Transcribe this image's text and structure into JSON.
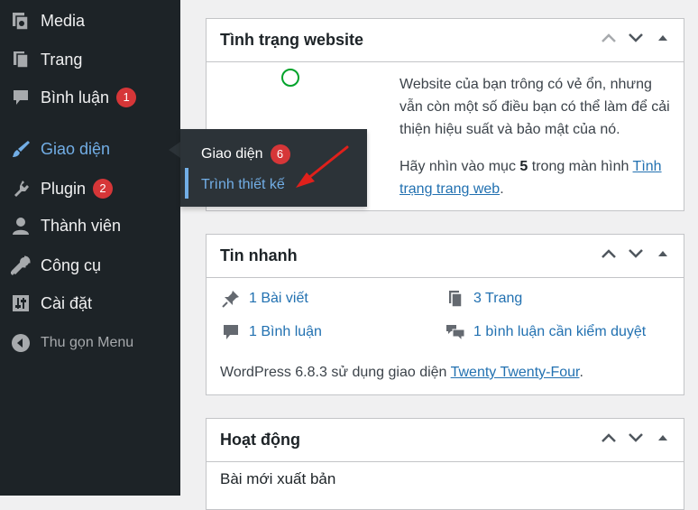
{
  "sidebar": {
    "items": [
      {
        "label": "Media",
        "icon": "media-icon"
      },
      {
        "label": "Trang",
        "icon": "pages-icon"
      },
      {
        "label": "Bình luận",
        "icon": "comments-icon",
        "badge": "1"
      },
      {
        "label": "Giao diện",
        "icon": "appearance-icon",
        "active": true
      },
      {
        "label": "Plugin",
        "icon": "plugins-icon",
        "badge": "2"
      },
      {
        "label": "Thành viên",
        "icon": "users-icon"
      },
      {
        "label": "Công cụ",
        "icon": "tools-icon"
      },
      {
        "label": "Cài đặt",
        "icon": "settings-icon"
      }
    ],
    "collapse_label": "Thu gọn Menu"
  },
  "flyout": {
    "title": "Giao diện",
    "badge": "6",
    "sub_item": "Trình thiết kế"
  },
  "site_health": {
    "title": "Tình trạng website",
    "message": "Website của bạn trông có vẻ ổn, nhưng vẫn còn một số điều bạn có thể làm để cải thiện hiệu suất và bảo mật của nó.",
    "hint_prefix": "Hãy nhìn vào mục",
    "hint_count": "5",
    "hint_middle": "trong màn hình",
    "hint_link": "Tình trạng trang web",
    "hint_suffix": "."
  },
  "at_a_glance": {
    "title": "Tin nhanh",
    "posts": "1 Bài viết",
    "pages": "3 Trang",
    "comments": "1 Bình luận",
    "moderation": "1 bình luận cần kiểm duyệt",
    "wp_prefix": "WordPress 6.8.3 sử dụng giao diện",
    "theme_link": "Twenty Twenty-Four",
    "wp_suffix": "."
  },
  "activity": {
    "title": "Hoạt động",
    "recent_label": "Bài mới xuất bản"
  },
  "colors": {
    "sidebar_bg": "#1d2327",
    "active": "#72aee6",
    "badge": "#d63638",
    "link": "#2271b1",
    "annotation_arrow": "#e0201b"
  }
}
